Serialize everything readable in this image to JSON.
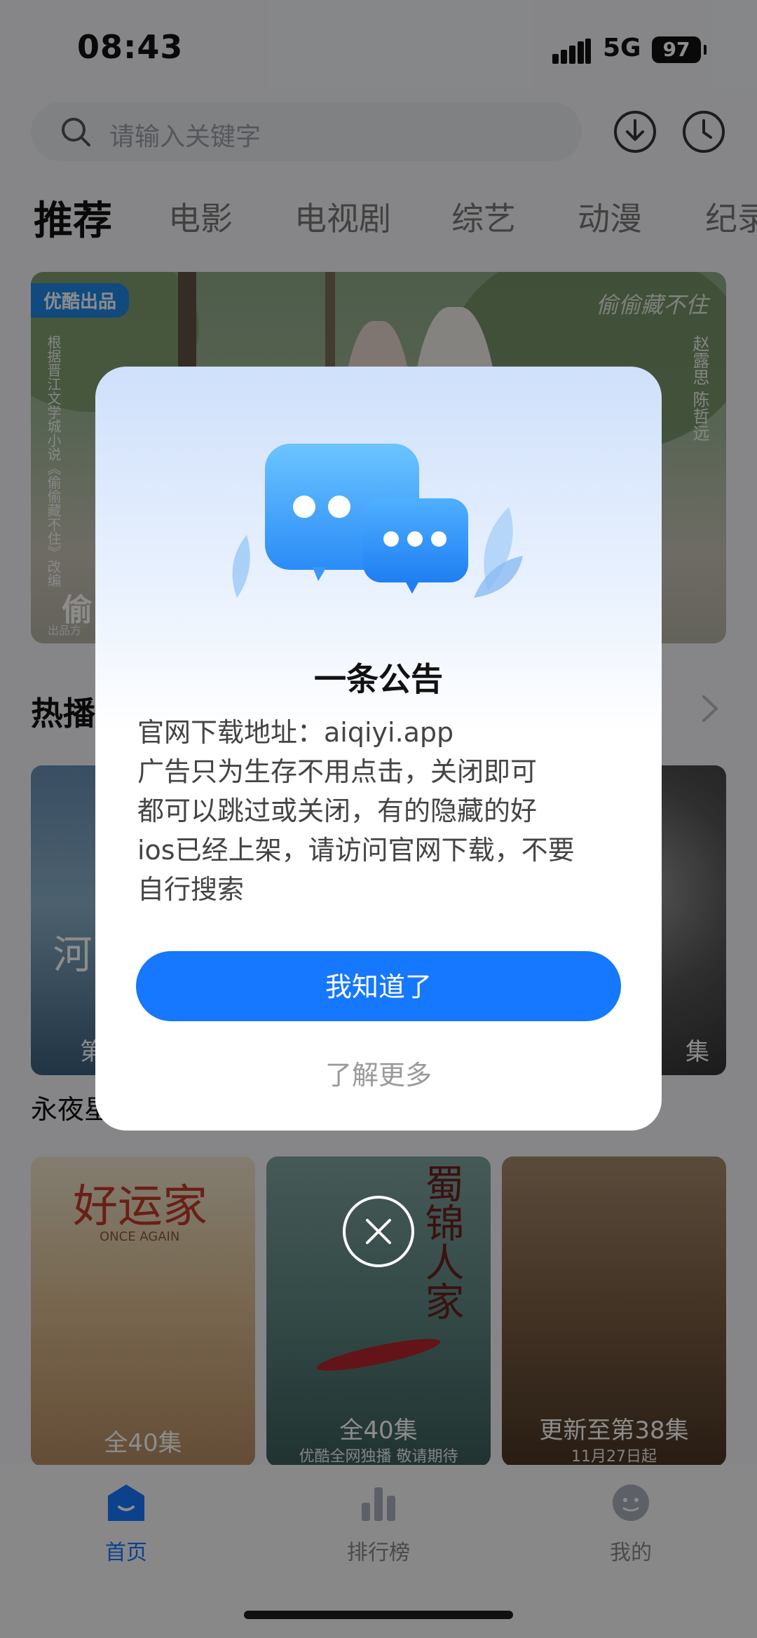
{
  "status_bar": {
    "time": "08:43",
    "network": "5G",
    "battery": "97"
  },
  "header": {
    "search_placeholder": "请输入关键字"
  },
  "tabs": [
    {
      "label": "推荐",
      "active": true
    },
    {
      "label": "电影"
    },
    {
      "label": "电视剧"
    },
    {
      "label": "综艺"
    },
    {
      "label": "动漫"
    },
    {
      "label": "纪录"
    }
  ],
  "banner": {
    "badge": "优酷出品",
    "brand": "偷偷藏不住",
    "title_partial": "偷",
    "producer_partial": "出品方",
    "vertical_text_left": "根据晋江文学城小说《偷偷藏不住》改编",
    "vertical_text_right": "赵露思 陈哲远"
  },
  "hot_section": {
    "title_partial": "热播"
  },
  "row1": {
    "left_poster_title": "永夜星河",
    "left_poster_cap_partial": "第",
    "right_poster_cap_partial": "集",
    "left_title_partial": "永夜星"
  },
  "row2": [
    {
      "cap": "全40集",
      "art_title": "好运家",
      "art_sub": "ONCE AGAIN"
    },
    {
      "cap": "全40集",
      "sub": "优酷全网独播 敬请期待",
      "art_title": "蜀锦人家"
    },
    {
      "cap": "更新至第38集",
      "sub": "11月27日起"
    }
  ],
  "bottom_nav": [
    {
      "label": "首页",
      "active": true,
      "icon": "home-icon"
    },
    {
      "label": "排行榜",
      "icon": "chart-icon"
    },
    {
      "label": "我的",
      "icon": "profile-icon"
    }
  ],
  "modal": {
    "title": "一条公告",
    "lines": [
      "官网下载地址：aiqiyi.app",
      "广告只为生存不用点击，关闭即可",
      "都可以跳过或关闭，有的隐藏的好",
      "ios已经上架，请访问官网下载，不要",
      "自行搜索"
    ],
    "ok_button": "我知道了",
    "more_link": "了解更多"
  },
  "colors": {
    "accent": "#1677ff",
    "badge": "#1e88e5",
    "overlay": "rgba(0,0,0,0.45)"
  }
}
